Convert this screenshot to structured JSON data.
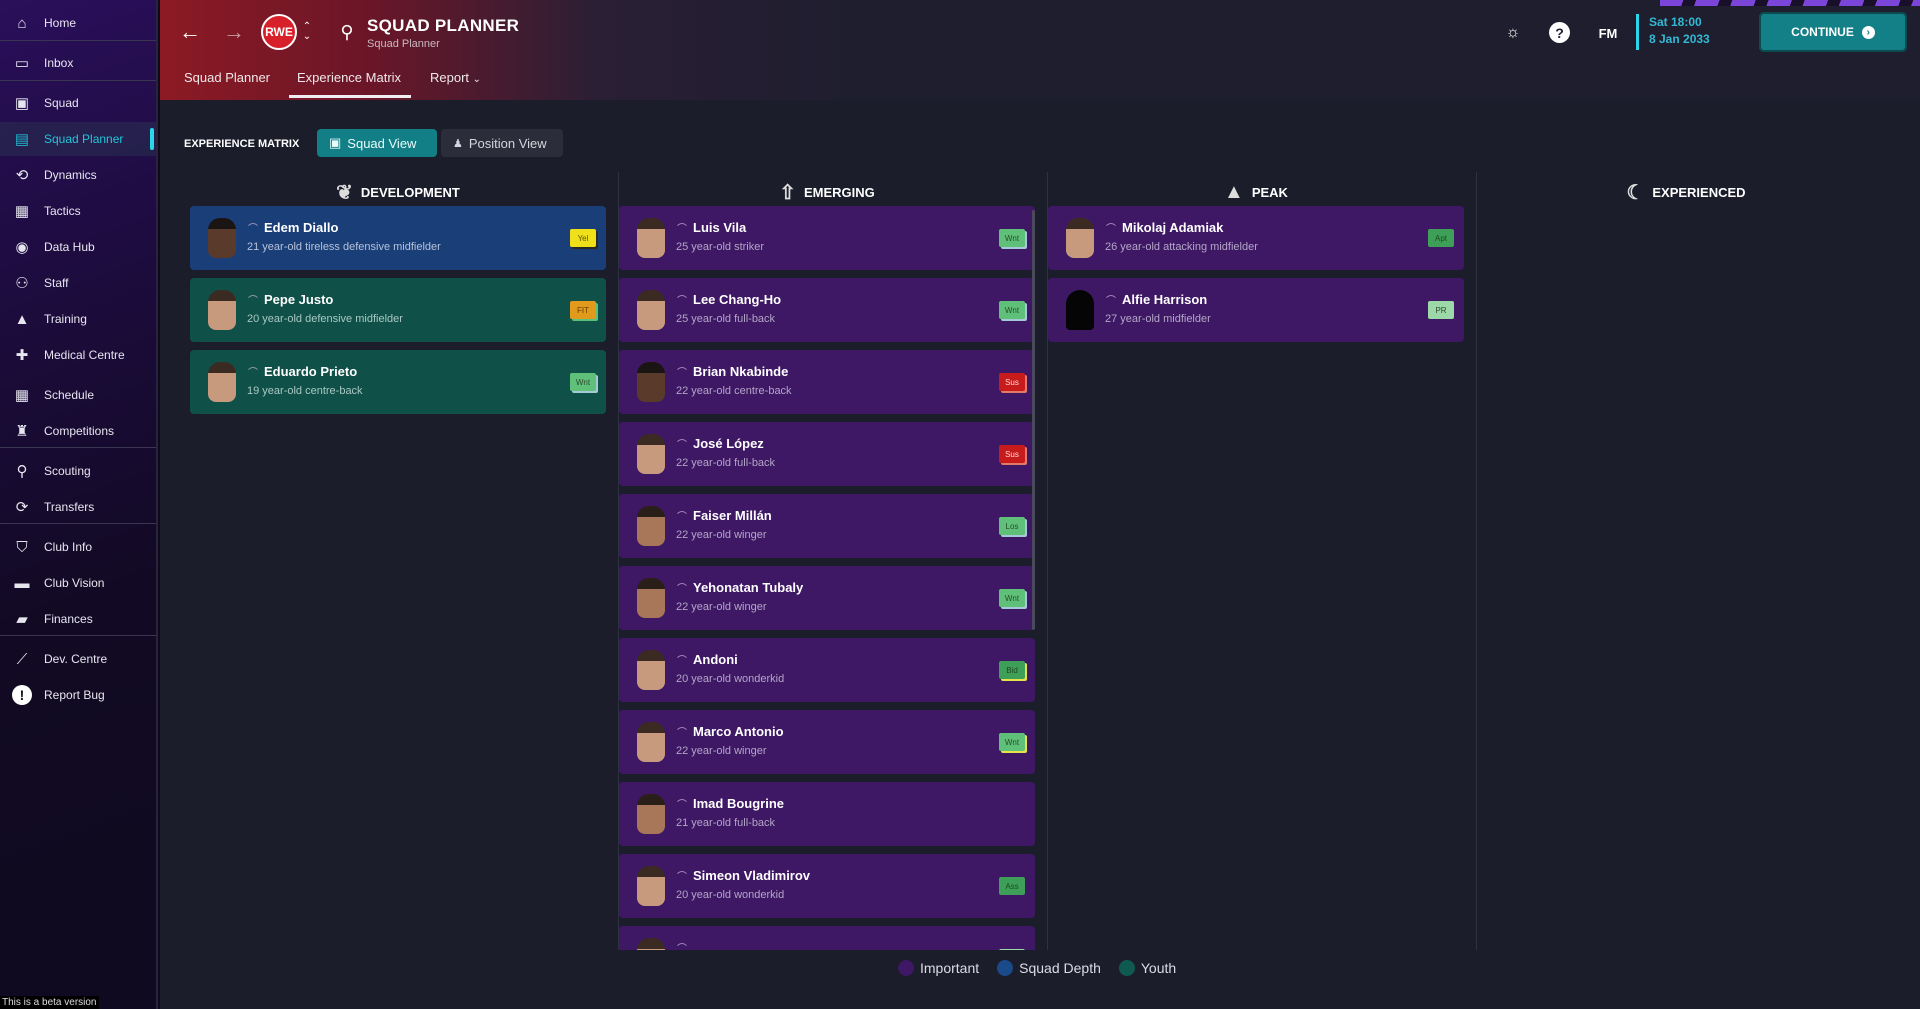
{
  "sidebar": {
    "items": [
      {
        "label": "Home",
        "icon": "home-icon"
      },
      {
        "label": "Inbox",
        "icon": "inbox-icon"
      },
      {
        "label": "Squad",
        "icon": "shirt-icon"
      },
      {
        "label": "Squad Planner",
        "icon": "clipboard-icon",
        "active": true
      },
      {
        "label": "Dynamics",
        "icon": "dynamics-icon"
      },
      {
        "label": "Tactics",
        "icon": "tactics-icon"
      },
      {
        "label": "Data Hub",
        "icon": "data-hub-icon"
      },
      {
        "label": "Staff",
        "icon": "staff-icon"
      },
      {
        "label": "Training",
        "icon": "training-icon"
      },
      {
        "label": "Medical Centre",
        "icon": "medical-icon"
      },
      {
        "label": "Schedule",
        "icon": "calendar-icon"
      },
      {
        "label": "Competitions",
        "icon": "trophy-icon"
      },
      {
        "label": "Scouting",
        "icon": "search-icon"
      },
      {
        "label": "Transfers",
        "icon": "transfer-icon"
      },
      {
        "label": "Club Info",
        "icon": "shield-icon"
      },
      {
        "label": "Club Vision",
        "icon": "briefcase-icon"
      },
      {
        "label": "Finances",
        "icon": "money-icon"
      },
      {
        "label": "Dev. Centre",
        "icon": "chart-icon"
      },
      {
        "label": "Report Bug",
        "icon": "alert-icon"
      }
    ],
    "beta_notice": "This is a beta version"
  },
  "header": {
    "title": "SQUAD PLANNER",
    "subtitle": "Squad Planner",
    "tabs": [
      {
        "label": "Squad Planner"
      },
      {
        "label": "Experience Matrix",
        "active": true
      },
      {
        "label": "Report"
      }
    ],
    "fm_label": "FM",
    "date_time": "Sat 18:00",
    "date": "8 Jan 2033",
    "continue_label": "CONTINUE"
  },
  "matrix": {
    "label": "EXPERIENCE MATRIX",
    "squad_view_label": "Squad View",
    "position_view_label": "Position View",
    "columns": [
      {
        "title": "DEVELOPMENT",
        "icon": "sprout-icon",
        "players": [
          {
            "name": "Edem Diallo",
            "desc": "21 year-old tireless defensive midfielder",
            "type": "depth",
            "badge": "Yel",
            "badge_style": "yellow",
            "face": "dark"
          },
          {
            "name": "Pepe Justo",
            "desc": "20 year-old defensive midfielder",
            "type": "youth",
            "badge": "FIT",
            "badge_style": "orange",
            "face": "light"
          },
          {
            "name": "Eduardo Prieto",
            "desc": "19 year-old centre-back",
            "type": "youth",
            "badge": "Wnt",
            "badge_style": "green",
            "face": "light"
          }
        ]
      },
      {
        "title": "EMERGING",
        "icon": "rocket-icon",
        "players": [
          {
            "name": "Luis Vila",
            "desc": "25 year-old striker",
            "type": "important",
            "badge": "Wnt",
            "badge_style": "green",
            "face": "light"
          },
          {
            "name": "Lee Chang-Ho",
            "desc": "25 year-old full-back",
            "type": "important",
            "badge": "Wnt",
            "badge_style": "green",
            "face": "light"
          },
          {
            "name": "Brian Nkabinde",
            "desc": "22 year-old centre-back",
            "type": "important",
            "badge": "Sus",
            "badge_style": "red",
            "face": "dark"
          },
          {
            "name": "José López",
            "desc": "22 year-old full-back",
            "type": "important",
            "badge": "Sus",
            "badge_style": "red",
            "face": "light"
          },
          {
            "name": "Faiser Millán",
            "desc": "22 year-old winger",
            "type": "important",
            "badge": "Los",
            "badge_style": "green",
            "face": "mid"
          },
          {
            "name": "Yehonatan Tubaly",
            "desc": "22 year-old winger",
            "type": "important",
            "badge": "Wnt",
            "badge_style": "green",
            "face": "mid"
          },
          {
            "name": "Andoni",
            "desc": "20 year-old wonderkid",
            "type": "important",
            "badge": "Bid",
            "badge_style": "dgreen-y",
            "face": "light"
          },
          {
            "name": "Marco Antonio",
            "desc": "22 year-old winger",
            "type": "important",
            "badge": "Wnt",
            "badge_style": "green-y",
            "face": "light"
          },
          {
            "name": "Imad Bougrine",
            "desc": "21 year-old full-back",
            "type": "important",
            "badge": "",
            "badge_style": "",
            "face": "mid"
          },
          {
            "name": "Simeon Vladimirov",
            "desc": "20 year-old wonderkid",
            "type": "important",
            "badge": "Ass",
            "badge_style": "dgreen",
            "face": "light"
          },
          {
            "name": "",
            "desc": "",
            "type": "important",
            "badge": "",
            "badge_style": "light",
            "face": "light"
          }
        ]
      },
      {
        "title": "PEAK",
        "icon": "mountain-icon",
        "players": [
          {
            "name": "Mikolaj Adamiak",
            "desc": "26 year-old attacking midfielder",
            "type": "important",
            "badge": "Apt",
            "badge_style": "dgreen",
            "face": "light"
          },
          {
            "name": "Alfie Harrison",
            "desc": "27 year-old midfielder",
            "type": "important",
            "badge": "PR",
            "badge_style": "light",
            "face": "sil"
          }
        ]
      },
      {
        "title": "EXPERIENCED",
        "icon": "moon-icon",
        "players": []
      }
    ]
  },
  "legend": [
    {
      "label": "Important",
      "color": "#3e1765"
    },
    {
      "label": "Squad Depth",
      "color": "#1a4a8a"
    },
    {
      "label": "Youth",
      "color": "#0f5a50"
    }
  ]
}
